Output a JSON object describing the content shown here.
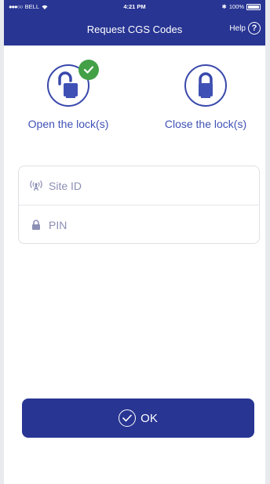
{
  "status_bar": {
    "carrier": "BELL",
    "time": "4:21 PM",
    "battery": "100%"
  },
  "nav": {
    "title": "Request CGS Codes",
    "help_label": "Help",
    "help_icon": "?"
  },
  "locks": {
    "open_label": "Open the lock(s)",
    "close_label": "Close the lock(s)"
  },
  "form": {
    "site_id_placeholder": "Site ID",
    "pin_placeholder": "PIN"
  },
  "ok_button": {
    "label": "OK"
  },
  "colors": {
    "primary": "#283593",
    "accent": "#3f51b5",
    "success": "#43a047"
  }
}
